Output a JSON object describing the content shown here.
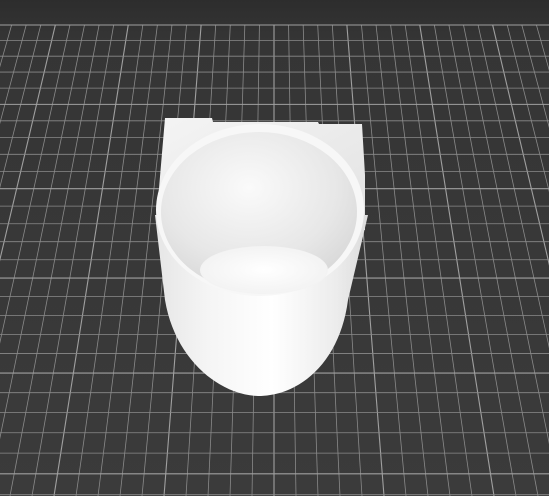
{
  "scene": {
    "view": "3d-model-preview",
    "background_color": "#3a3a3a",
    "grid_line_color": "#8a8a8a",
    "grid_major_line_color": "#a0a0a0",
    "model_color": "#f2f2f2",
    "model_shade_color": "#d8d8d8",
    "model": {
      "icon": "cup-holder-model-icon",
      "shape": "cylindrical cup with flat back mounting plate"
    }
  }
}
